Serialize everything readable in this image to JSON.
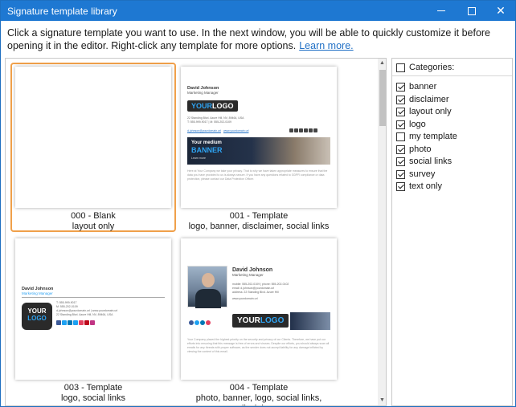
{
  "window": {
    "title": "Signature template library",
    "minimize_label": "—",
    "maximize_label": "",
    "close_label": "✕"
  },
  "description": {
    "text": "Click a signature template you want to use. In the next window, you will be able to quickly customize it before opening it in the editor. Right-click any template for more options.",
    "link": "Learn more."
  },
  "templates": [
    {
      "line1": "000 - Blank",
      "line2": "layout only"
    },
    {
      "line1": "001 - Template",
      "line2": "logo, banner, disclaimer, social links"
    },
    {
      "line1": "003 - Template",
      "line2": "logo, social links"
    },
    {
      "line1": "004 - Template",
      "line2": "photo, banner, logo, social links, disclaimer"
    }
  ],
  "previews": {
    "t001": {
      "name": "David Johnson",
      "role": "Marketing Manager",
      "logo_a": "YOUR",
      "logo_b": "LOGO",
      "address": "22 Standing Blvd. Azure Hill, NV, 89464, USA",
      "phones": "T: 555-999-9017 | M: 555-202-0109",
      "email": "d.johnson@yourdomain.url",
      "web": "www.yourdomain.url",
      "banner_top": "Your medium",
      "banner_main": "BANNER",
      "banner_small": "Learn more",
      "disclaimer": "Here at Your Company we take your privacy. That is why we have taken appropriate measures to ensure that the data you have provided to us is always secure. If you have any questions related to GDPR compliance or data protection, please contact our Data Protection Officer."
    },
    "t003": {
      "name": "David Johnson",
      "role": "Marketing Manager",
      "logo_a": "YOUR",
      "logo_b": "LOGO",
      "phone1": "T: 555-999-9017",
      "phone2": "M: 555-202-0109",
      "email": "d.johnson@yourdomain.url | www.yourdomain.url",
      "address": "22 Standing Blvd. Azure Hill, NV, 89464, USA"
    },
    "t004": {
      "name": "David Johnson",
      "role": "Marketing Manager",
      "phones": "mobile: 555-202-0109 | phone: 555-202-0102",
      "email": "email: d.johnson@yourdomain.url",
      "address": "address: 22 Standing Blvd. Azure Hill",
      "web": "www.yourdomain.url",
      "logo_a": "YOUR",
      "logo_b": "LOGO",
      "disclaimer": "Your Company placed the highest priority on the security and privacy of our Clients. Therefore, we have put our efforts into ensuring that this message is free of errors and viruses. Despite our efforts, you should always scan all emails for any threats with proper software, as the sender does not accept liability for any damage inflicted by viewing the content of this email."
    }
  },
  "categories": {
    "header": "Categories:",
    "items": [
      {
        "label": "banner",
        "checked": true
      },
      {
        "label": "disclaimer",
        "checked": true
      },
      {
        "label": "layout only",
        "checked": true
      },
      {
        "label": "logo",
        "checked": true
      },
      {
        "label": "my template",
        "checked": false
      },
      {
        "label": "photo",
        "checked": true
      },
      {
        "label": "social links",
        "checked": true
      },
      {
        "label": "survey",
        "checked": true
      },
      {
        "label": "text only",
        "checked": true
      }
    ]
  },
  "colors": {
    "titlebar": "#1e78d2",
    "selection": "#f0a04a",
    "link": "#1f6fc5",
    "logo_accent": "#2ea3f2",
    "logo_bg": "#2a2a2a"
  }
}
